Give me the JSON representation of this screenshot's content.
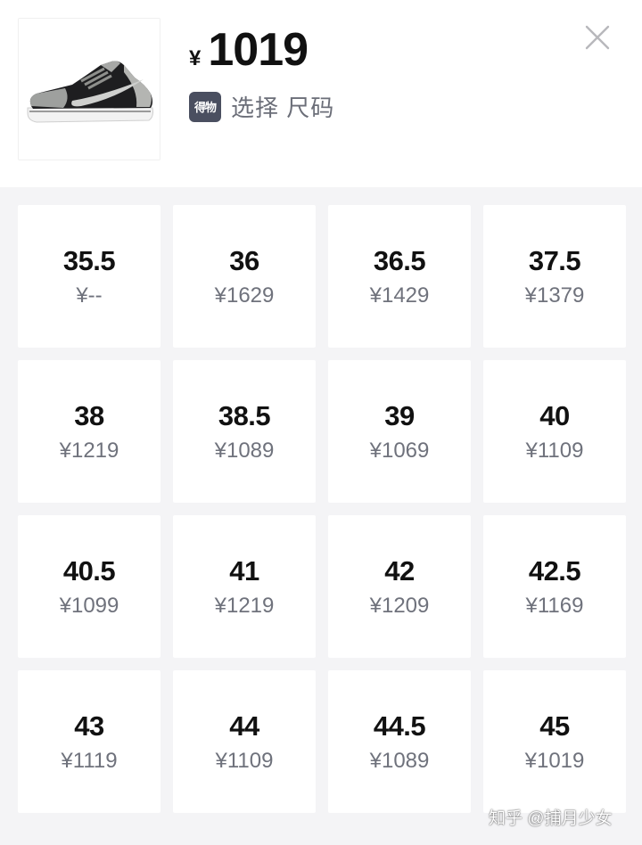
{
  "product": {
    "currency": "¥",
    "price": "1019",
    "badge_text": "得物",
    "select_prompt": "选择 尺码"
  },
  "sizes": [
    {
      "size": "35.5",
      "price": "¥--"
    },
    {
      "size": "36",
      "price": "¥1629"
    },
    {
      "size": "36.5",
      "price": "¥1429"
    },
    {
      "size": "37.5",
      "price": "¥1379"
    },
    {
      "size": "38",
      "price": "¥1219"
    },
    {
      "size": "38.5",
      "price": "¥1089"
    },
    {
      "size": "39",
      "price": "¥1069"
    },
    {
      "size": "40",
      "price": "¥1109"
    },
    {
      "size": "40.5",
      "price": "¥1099"
    },
    {
      "size": "41",
      "price": "¥1219"
    },
    {
      "size": "42",
      "price": "¥1209"
    },
    {
      "size": "42.5",
      "price": "¥1169"
    },
    {
      "size": "43",
      "price": "¥1119"
    },
    {
      "size": "44",
      "price": "¥1109"
    },
    {
      "size": "44.5",
      "price": "¥1089"
    },
    {
      "size": "45",
      "price": "¥1019"
    }
  ],
  "watermark": "知乎 @捕月少女",
  "icons": {
    "close": "close-icon",
    "product": "sneaker-image"
  }
}
